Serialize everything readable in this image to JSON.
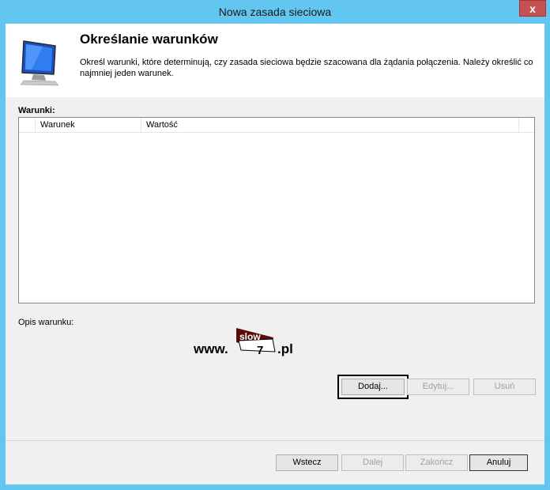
{
  "window": {
    "title": "Nowa zasada sieciowa",
    "close_glyph": "x"
  },
  "header": {
    "title": "Określanie warunków",
    "description": "Określ warunki, które determinują, czy zasada sieciowa będzie szacowana dla żądania połączenia. Należy określić co najmniej jeden warunek.",
    "icon": "monitor-icon"
  },
  "conditions": {
    "label": "Warunki:",
    "columns": [
      "Warunek",
      "Wartość"
    ],
    "rows": []
  },
  "condition_description": {
    "label": "Opis warunku:"
  },
  "logo": {
    "prefix": "www.",
    "top": "slow",
    "number": "7",
    "suffix": ".pl"
  },
  "condition_buttons": {
    "add": "Dodaj...",
    "edit": "Edytuj...",
    "remove": "Usuń"
  },
  "nav_buttons": {
    "back": "Wstecz",
    "next": "Dalej",
    "finish": "Zakończ",
    "cancel": "Anuluj"
  }
}
